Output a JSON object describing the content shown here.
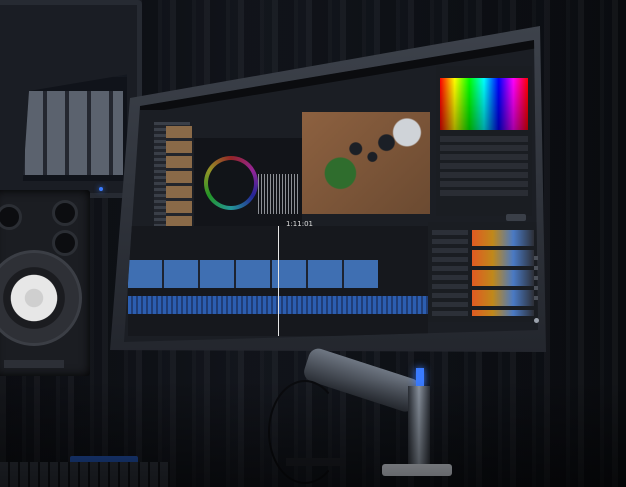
{
  "scene": {
    "description_tags": [
      "studio-desk",
      "computer-monitor",
      "video-editing-software",
      "speaker",
      "acoustic-foam",
      "keyboard",
      "monitor-arm"
    ]
  },
  "monitor": {
    "screen_timecode": "1:11:01"
  },
  "colors": {
    "accent_blue": "#3a7bff",
    "timeline_clip": "#3f6fb2",
    "effect_orange": "#e05a22"
  }
}
